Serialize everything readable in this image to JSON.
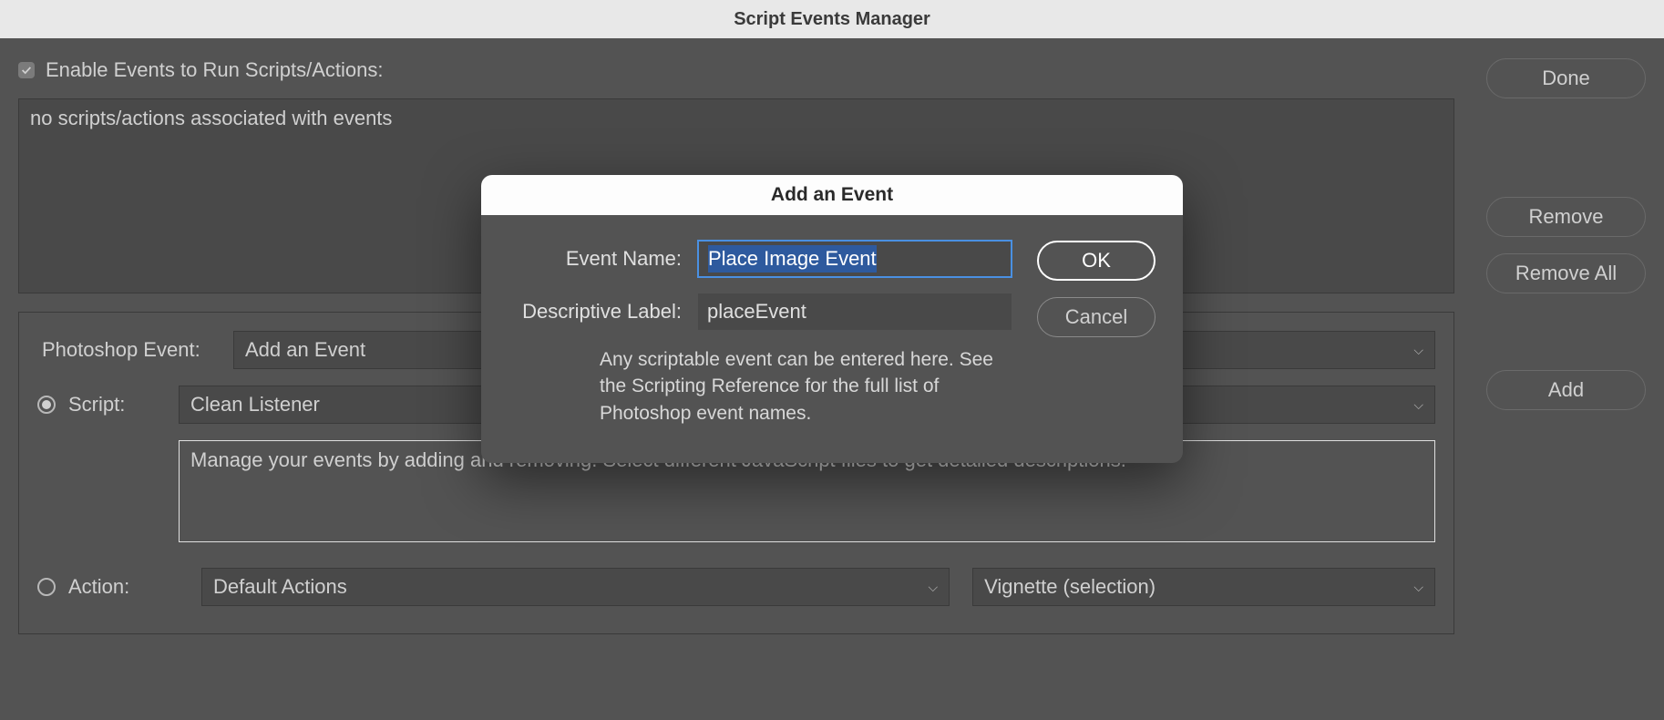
{
  "window": {
    "title": "Script Events Manager"
  },
  "main": {
    "enable_checkbox_label": "Enable Events to Run Scripts/Actions:",
    "listbox_text": "no scripts/actions associated with events",
    "photoshop_event_label": "Photoshop Event:",
    "photoshop_event_value": "Add an Event",
    "script_label": "Script:",
    "script_value": "Clean Listener",
    "description_text": "Manage your events by adding and removing. Select different JavaScript files to get detailed descriptions.",
    "action_label": "Action:",
    "action_set_value": "Default Actions",
    "action_value": "Vignette (selection)"
  },
  "buttons": {
    "done": "Done",
    "remove": "Remove",
    "remove_all": "Remove All",
    "add": "Add"
  },
  "modal": {
    "title": "Add an Event",
    "event_name_label": "Event Name:",
    "event_name_value": "Place Image Event",
    "descriptive_label_label": "Descriptive Label:",
    "descriptive_label_value": "placeEvent",
    "help_text": "Any scriptable event can be entered here. See the Scripting Reference for the full list of Photoshop event names.",
    "ok": "OK",
    "cancel": "Cancel"
  }
}
